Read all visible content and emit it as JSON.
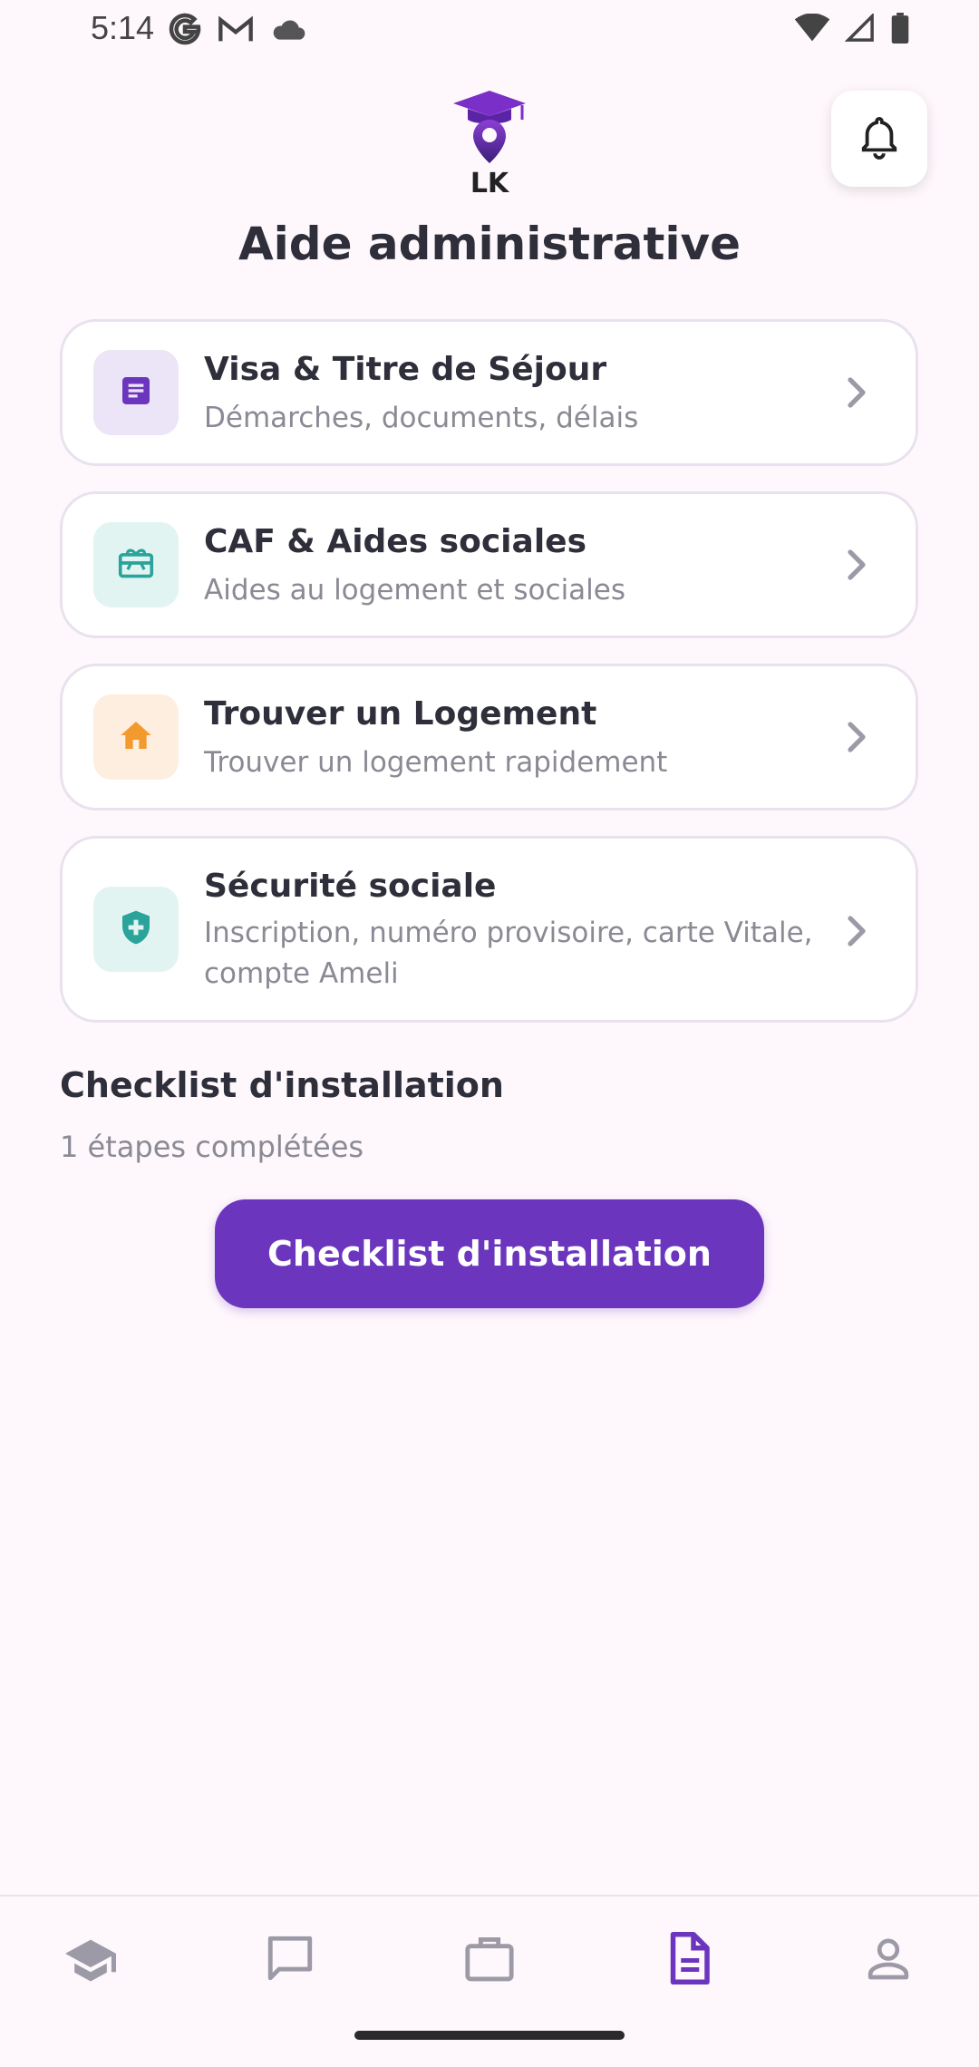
{
  "status_bar": {
    "time": "5:14",
    "left_icons": [
      "google-g-icon",
      "gmail-icon",
      "cloud-icon"
    ],
    "right_icons": [
      "wifi-icon",
      "signal-icon",
      "battery-icon"
    ]
  },
  "header": {
    "logo": "graduation-pin-logo",
    "logo_text": "LK",
    "title": "Aide administrative",
    "notification_icon": "bell-icon"
  },
  "cards": [
    {
      "title": "Visa & Titre de Séjour",
      "subtitle": "Démarches, documents, délais",
      "icon": "document-icon",
      "color": "#6B36BD",
      "bg": "#ECE4F7"
    },
    {
      "title": "CAF & Aides sociales",
      "subtitle": "Aides au logement et sociales",
      "icon": "gift-card-icon",
      "color": "#2AA39B",
      "bg": "#E2F4F2"
    },
    {
      "title": "Trouver un Logement",
      "subtitle": "Trouver un logement rapidement",
      "icon": "home-icon",
      "color": "#F39A2E",
      "bg": "#FDEEE0"
    },
    {
      "title": "Sécurité sociale",
      "subtitle": "Inscription, numéro provisoire, carte Vitale, compte Ameli",
      "icon": "shield-plus-icon",
      "color": "#2AA39B",
      "bg": "#E2F4F2"
    }
  ],
  "checklist": {
    "title": "Checklist d'installation",
    "progress_text": "1 étapes complétées",
    "button_label": "Checklist d'installation"
  },
  "bottom_nav": {
    "items": [
      "school-icon",
      "chat-icon",
      "briefcase-icon",
      "document-icon",
      "profile-icon"
    ],
    "active_index": 3,
    "active_color": "#6B36BD",
    "inactive_color": "#9C9AA6"
  }
}
